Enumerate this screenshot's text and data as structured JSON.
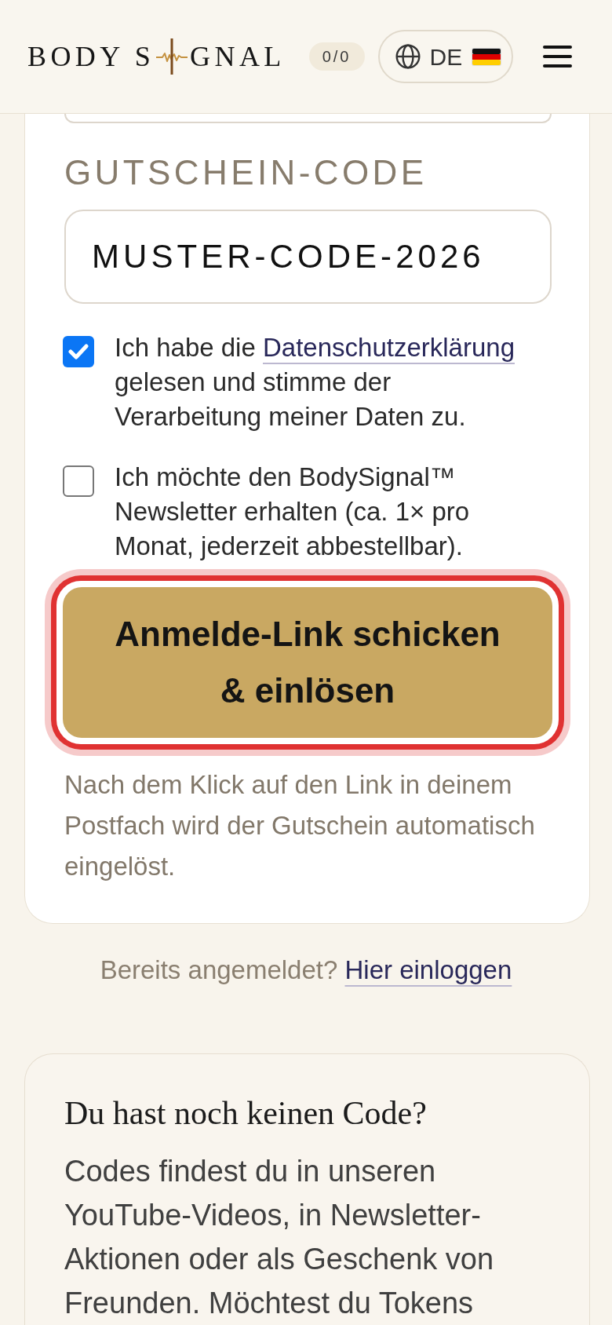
{
  "header": {
    "logo": {
      "text_before": "BODY S",
      "text_after": "GNAL"
    },
    "token_counter": "0/0",
    "language": {
      "code": "DE"
    }
  },
  "form": {
    "voucher_label": "GUTSCHEIN-CODE",
    "voucher_code": "MUSTER-CODE-2026",
    "consents": [
      {
        "checked": true,
        "text": "Ich habe die",
        "link": "Datenschutzerklärung",
        "text_after": "gelesen und stimme der Verarbeitung meiner Daten zu."
      },
      {
        "checked": false,
        "text": "Ich möchte den BodySignal™ Newsletter erhalten (ca. 1× pro Monat, jederzeit abbestellbar)."
      }
    ],
    "submit_button": {
      "label": "Anmelde-Link schicken & einlösen",
      "focused": true
    },
    "hint": "Nach dem Klick auf den Link in deinem Postfach wird der Gutschein automatisch eingelöst."
  },
  "login_prompt": {
    "text": "Bereits angemeldet?",
    "link": "Hier einloggen"
  },
  "info_card": {
    "title": "Du hast noch keinen Code?",
    "body": "Codes findest du in unseren YouTube-Videos, in Newsletter-Aktionen oder als Geschenk von Freunden. Möchtest du Tokens"
  }
}
